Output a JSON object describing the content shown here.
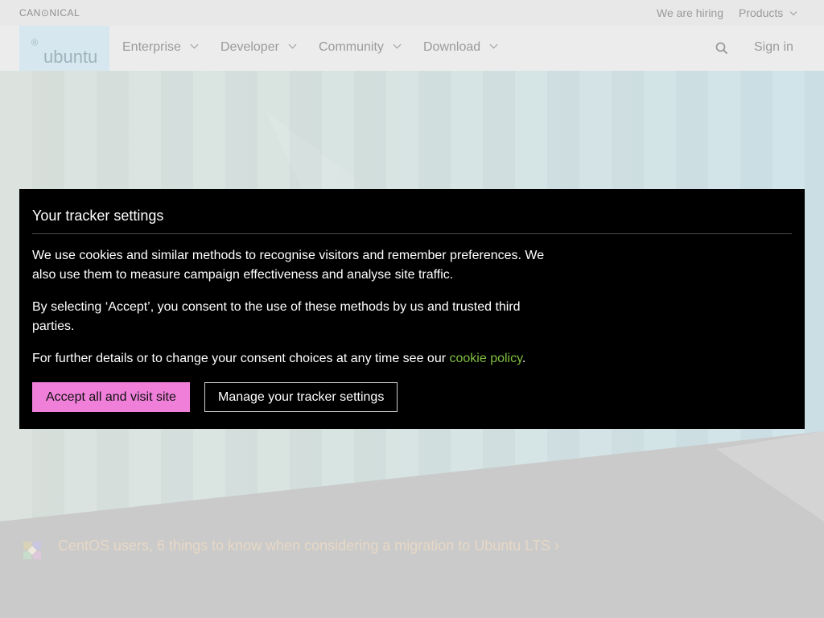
{
  "topbar": {
    "logo": "CAN⊙NICAL",
    "hiring": "We are hiring",
    "products": "Products"
  },
  "navbar": {
    "logo_text": "ubuntu",
    "logo_mark": "®",
    "items": [
      {
        "label": "Enterprise"
      },
      {
        "label": "Developer"
      },
      {
        "label": "Community"
      },
      {
        "label": "Download"
      }
    ],
    "signin": "Sign in"
  },
  "banner": {
    "text": "CentOS users, 6 things to know when considering a migration to Ubuntu LTS ›"
  },
  "modal": {
    "title": "Your tracker settings",
    "p1": "We use cookies and similar methods to recognise visitors and remember preferences. We also use them to measure campaign effectiveness and analyse site traffic.",
    "p2": "By selecting ‘Accept’, you consent to the use of these methods by us and trusted third parties.",
    "p3_prefix": "For further details or to change your consent choices at any time see our ",
    "p3_link": "cookie policy",
    "p3_suffix": ".",
    "accept_label": "Accept all and visit site",
    "manage_label": "Manage your tracker settings"
  },
  "colors": {
    "accept_button": "#f07fd9",
    "link": "#7fbf3f",
    "modal_bg": "#000000"
  }
}
